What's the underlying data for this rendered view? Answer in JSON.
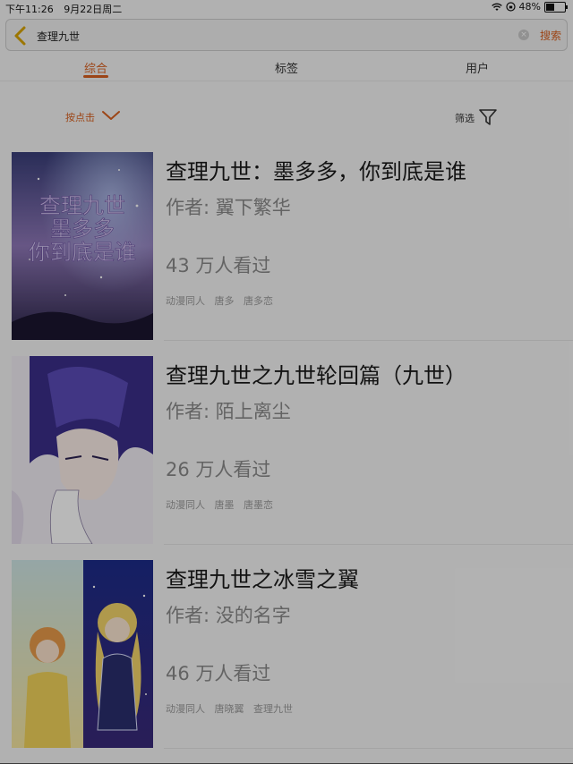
{
  "status": {
    "time": "下午11:26",
    "date": "9月22日周二",
    "battery": "48%",
    "battery_level": 0.48
  },
  "search": {
    "query": "查理九世",
    "clear_glyph": "×",
    "submit": "搜索"
  },
  "tabs": [
    "综合",
    "标签",
    "用户"
  ],
  "filters": {
    "sort": "按点击",
    "filter": "筛选"
  },
  "results": [
    {
      "title": "查理九世：墨多多，你到底是谁",
      "author": "作者: 翼下繁华",
      "views": "43 万人看过",
      "tags": [
        "动漫同人",
        "唐多",
        "唐多恋"
      ],
      "cover_text": [
        "查理九世",
        "墨多多",
        "你到底是谁"
      ]
    },
    {
      "title": "查理九世之九世轮回篇（九世）",
      "author": "作者: 陌上离尘",
      "views": "26 万人看过",
      "tags": [
        "动漫同人",
        "唐墨",
        "唐墨恋"
      ]
    },
    {
      "title": "查理九世之冰雪之翼",
      "author": "作者: 没的名字",
      "views": "46 万人看过",
      "tags": [
        "动漫同人",
        "唐晓翼",
        "查理九世"
      ]
    }
  ],
  "colors": {
    "accent": "#d9601f",
    "background": "#f6f6f6"
  }
}
